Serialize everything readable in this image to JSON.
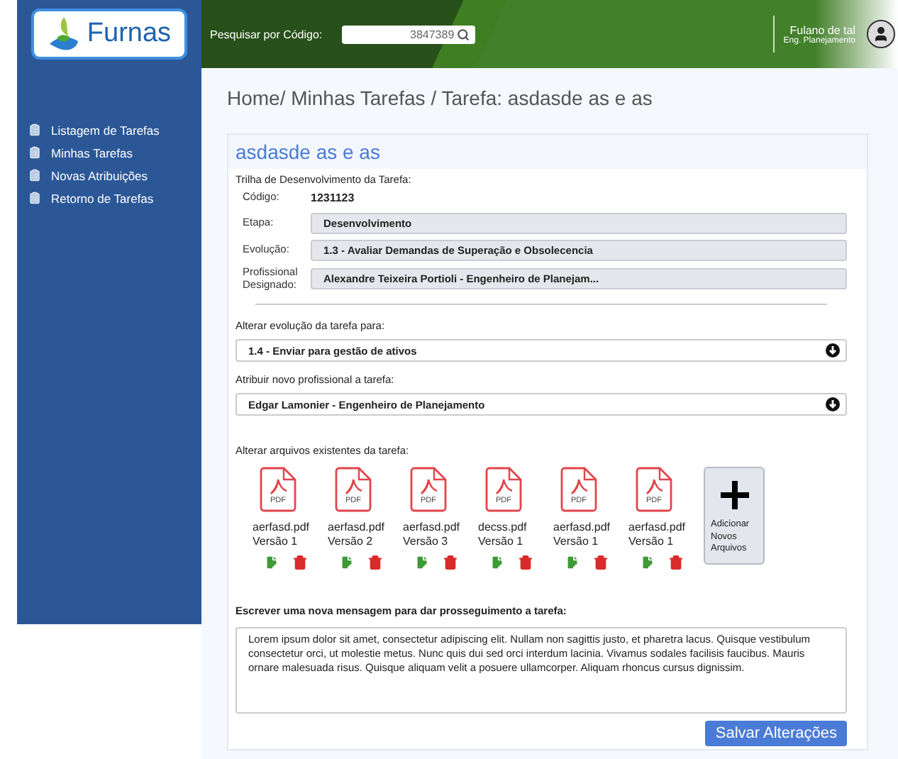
{
  "header": {
    "logo": "Furnas",
    "search_label": "Pesquisar por Código:",
    "search_value": "3847389",
    "user_name": "Fulano de tal",
    "user_role": "Eng. Planejamento"
  },
  "sidebar": {
    "items": [
      {
        "label": "Listagem de Tarefas"
      },
      {
        "label": "Minhas Tarefas"
      },
      {
        "label": "Novas Atribuições"
      },
      {
        "label": "Retorno de Tarefas"
      }
    ]
  },
  "breadcrumb": "Home/ Minhas Tarefas / Tarefa: asdasde as e as",
  "task": {
    "title": "asdasde as e as",
    "trail_label": "Trilha de Desenvolvimento da Tarefa:",
    "code_label": "Código:",
    "code": "1231123",
    "fields": [
      {
        "label": "Etapa:",
        "value": "Desenvolvimento"
      },
      {
        "label": "Evolução:",
        "value": "1.3 - Avaliar Demandas de Superação e Obsolecencia"
      },
      {
        "label": "Profissional Designado:",
        "value": "Alexandre Teixeira Portioli - Engenheiro de Planejam..."
      }
    ],
    "selects": [
      {
        "label": "Alterar evolução da tarefa para:",
        "value": "1.4 - Enviar para gestão de ativos"
      },
      {
        "label": "Atribuir novo profissional a tarefa:",
        "value": "Edgar Lamonier - Engenheiro de Planejamento"
      }
    ],
    "files_label": "Alterar arquivos existentes da tarefa:",
    "files": [
      {
        "type": "PDF",
        "name": "aerfasd.pdf",
        "version": "Versão 1"
      },
      {
        "type": "PDF",
        "name": "aerfasd.pdf",
        "version": "Versão 2"
      },
      {
        "type": "PDF",
        "name": "aerfasd.pdf",
        "version": "Versão 3"
      },
      {
        "type": "PDF",
        "name": "decss.pdf",
        "version": "Versão 1"
      },
      {
        "type": "PDF",
        "name": "aerfasd.pdf",
        "version": "Versão 1"
      },
      {
        "type": "PDF",
        "name": "aerfasd.pdf",
        "version": "Versão 1"
      }
    ],
    "add_files": "Adicionar Novos Arquivos",
    "message_label": "Escrever uma nova mensagem para dar prosseguimento a tarefa:",
    "message": "Lorem ipsum dolor sit amet, consectetur adipiscing elit. Nullam non sagittis justo, et pharetra lacus. Quisque vestibulum consectetur orci, ut molestie metus. Nunc quis dui sed orci interdum lacinia. Vivamus sodales facilisis faucibus. Mauris ornare malesuada risus. Quisque aliquam velit a posuere ullamcorper. Aliquam rhoncus cursus dignissim.",
    "save": "Salvar Alterações"
  }
}
